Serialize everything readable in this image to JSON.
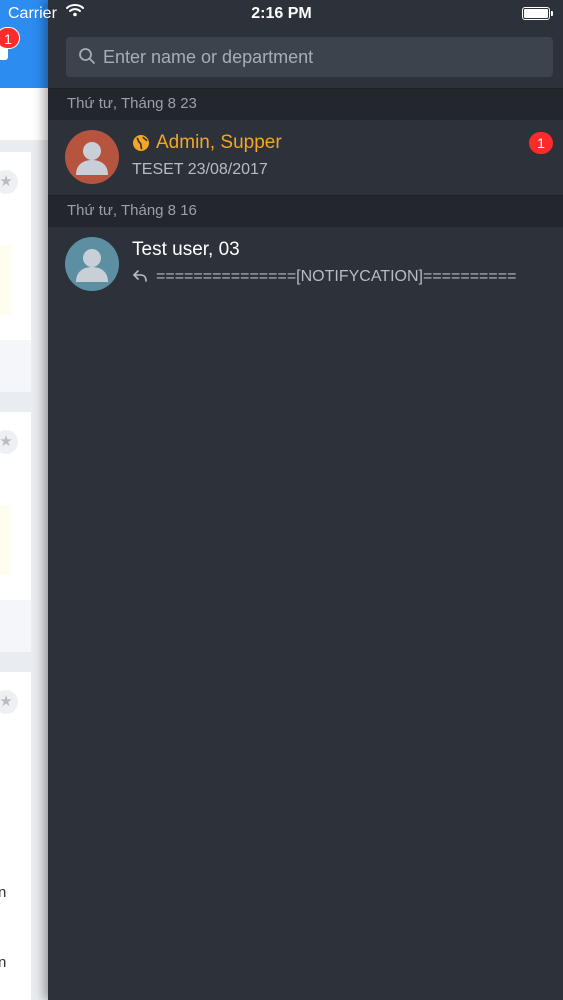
{
  "status_bar": {
    "carrier": "Carrier",
    "time": "2:16 PM"
  },
  "background_app": {
    "notification_count": "1",
    "accent_color": "#2d8cf0",
    "visible_fragments": [
      "n",
      "n"
    ]
  },
  "search": {
    "placeholder": "Enter name or department"
  },
  "sections": [
    {
      "header": "Thứ tư, Tháng 8 23",
      "conversations": [
        {
          "name": "Admin, Supper",
          "name_color": "#f5a623",
          "icon": "globe-icon",
          "subtitle": "TESET 23/08/2017",
          "unread": "1",
          "avatar_color": "#b6543f"
        }
      ]
    },
    {
      "header": "Thứ tư, Tháng 8 16",
      "conversations": [
        {
          "name": "Test user, 03",
          "name_color": "#ffffff",
          "icon": "reply-icon",
          "subtitle": "===============[NOTIFYCATION]==========",
          "avatar_color": "#5d8fa3"
        }
      ]
    }
  ]
}
